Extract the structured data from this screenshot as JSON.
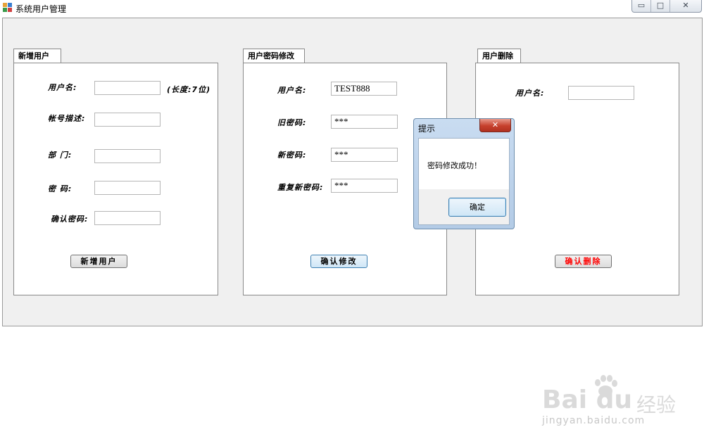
{
  "window": {
    "title": "系统用户管理",
    "controls": {
      "minimize": "▭",
      "maximize": "□",
      "close": "✕"
    }
  },
  "add_user": {
    "tab": "新增用户",
    "labels": {
      "username": "用户名:",
      "length_hint": "(长度:7位)",
      "account_desc": "帐号描述:",
      "department": "部 门:",
      "password": "密 码:",
      "confirm_password": "确认密码:"
    },
    "values": {
      "username": "",
      "account_desc": "",
      "department": "",
      "password": "",
      "confirm_password": ""
    },
    "button": "新增用户"
  },
  "change_password": {
    "tab": "用户密码修改",
    "labels": {
      "username": "用户名:",
      "old_password": "旧密码:",
      "new_password": "新密码:",
      "repeat_password": "重复新密码:"
    },
    "values": {
      "username": "TEST888",
      "old_password": "***",
      "new_password": "***",
      "repeat_password": "***"
    },
    "button": "确认修改"
  },
  "delete_user": {
    "tab": "用户删除",
    "labels": {
      "username": "用户名:"
    },
    "values": {
      "username": ""
    },
    "button": "确认删除",
    "button_color": "#ff0000"
  },
  "dialog": {
    "title": "提示",
    "message": "密码修改成功！",
    "ok": "确定",
    "close": "✕"
  },
  "watermark": {
    "logo": "Bai du",
    "text": "经验",
    "url": "jingyan.baidu.com"
  },
  "colors": {
    "window_bg": "#f0f0f0",
    "dialog_frame": "#b3cbe6",
    "delete_text": "#ff0000"
  }
}
